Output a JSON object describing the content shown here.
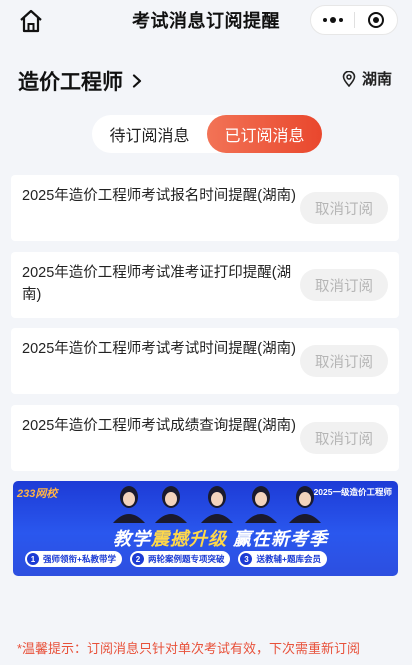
{
  "header": {
    "title": "考试消息订阅提醒"
  },
  "subject": {
    "name": "造价工程师",
    "location": "湖南"
  },
  "tabs": [
    {
      "label": "待订阅消息",
      "active": false
    },
    {
      "label": "已订阅消息",
      "active": true
    }
  ],
  "subscriptions": [
    {
      "title": "2025年造价工程师考试报名时间提醒(湖南)",
      "action": "取消订阅"
    },
    {
      "title": "2025年造价工程师考试准考证打印提醒(湖南)",
      "action": "取消订阅"
    },
    {
      "title": "2025年造价工程师考试考试时间提醒(湖南)",
      "action": "取消订阅"
    },
    {
      "title": "2025年造价工程师考试成绩查询提醒(湖南)",
      "action": "取消订阅"
    }
  ],
  "banner": {
    "logo": "233网校",
    "tag": "2025一级造价工程师",
    "headline_a": "教学",
    "headline_b": "震撼升级",
    "headline_c": " 赢在新考季",
    "pills": [
      {
        "num": "1",
        "text": "强师领衔+私教带学"
      },
      {
        "num": "2",
        "text": "两轮案例题专项突破"
      },
      {
        "num": "3",
        "text": "送教辅+题库会员"
      }
    ]
  },
  "footer": {
    "tip": "*温馨提示：订阅消息只针对单次考试有效，下次需重新订阅"
  },
  "colors": {
    "accent": "#e9472d",
    "tip": "#e8513a",
    "banner_blue": "#2a57ee"
  }
}
